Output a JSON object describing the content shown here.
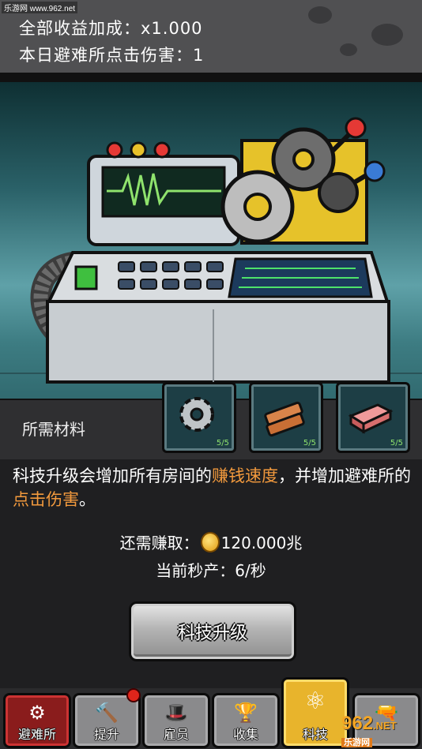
{
  "watermark": "乐游网 www.962.net",
  "stats": {
    "total_bonus": "全部收益加成：x1.000",
    "today_clicks": "本日避难所点击伤害：1"
  },
  "materials": {
    "label": "所需材料",
    "items": [
      {
        "icon": "gear-icon",
        "count": "5/5"
      },
      {
        "icon": "wood-plank-icon",
        "count": "5/5"
      },
      {
        "icon": "brick-icon",
        "count": "5/5"
      }
    ]
  },
  "description": {
    "part1": "科技升级会增加所有房间的",
    "highlight1": "赚钱速度",
    "part2": "，并增加避难所的",
    "highlight2": "点击伤害",
    "part3": "。"
  },
  "requirement": {
    "label": "还需赚取：",
    "value": "120.000兆"
  },
  "rate": "当前秒产：6/秒",
  "upgrade_button": "科技升级",
  "nav": {
    "tabs": [
      {
        "label": "避难所",
        "icon": "gear-house-icon",
        "state": "active"
      },
      {
        "label": "提升",
        "icon": "hammer-icon",
        "badge": true
      },
      {
        "label": "雇员",
        "icon": "hat-icon"
      },
      {
        "label": "收集",
        "icon": "trophy-icon"
      },
      {
        "label": "科技",
        "icon": "atom-icon",
        "state": "selected"
      },
      {
        "label": "",
        "icon": "gun-icon"
      }
    ]
  },
  "logo": {
    "big": "962",
    "small": "乐游网",
    "net": ".NET"
  },
  "colors": {
    "highlight": "#f39a3d",
    "selected_tab": "#e8b42c",
    "active_tab": "#8a1c1c"
  }
}
